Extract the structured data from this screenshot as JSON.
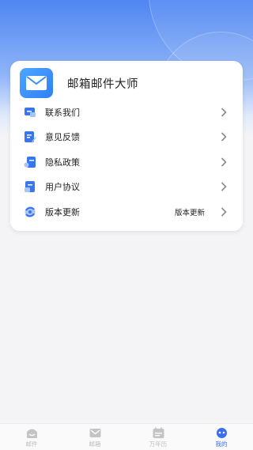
{
  "app": {
    "title": "邮箱邮件大师",
    "logo_icon": "mail-envelope-icon",
    "accent": "#3a6ff0"
  },
  "menu": [
    {
      "label": "联系我们",
      "icon": "contact-chat-icon"
    },
    {
      "label": "意见反馈",
      "icon": "feedback-edit-icon"
    },
    {
      "label": "隐私政策",
      "icon": "privacy-document-icon"
    },
    {
      "label": "用户协议",
      "icon": "agreement-document-icon"
    },
    {
      "label": "版本更新",
      "icon": "update-refresh-icon",
      "extra": "版本更新"
    }
  ],
  "tabs": [
    {
      "label": "邮件",
      "icon": "mail-tab-icon",
      "active": false
    },
    {
      "label": "邮箱",
      "icon": "mailbox-tab-icon",
      "active": false
    },
    {
      "label": "万年历",
      "icon": "calendar-tab-icon",
      "active": false
    },
    {
      "label": "我的",
      "icon": "profile-tab-icon",
      "active": true
    }
  ]
}
